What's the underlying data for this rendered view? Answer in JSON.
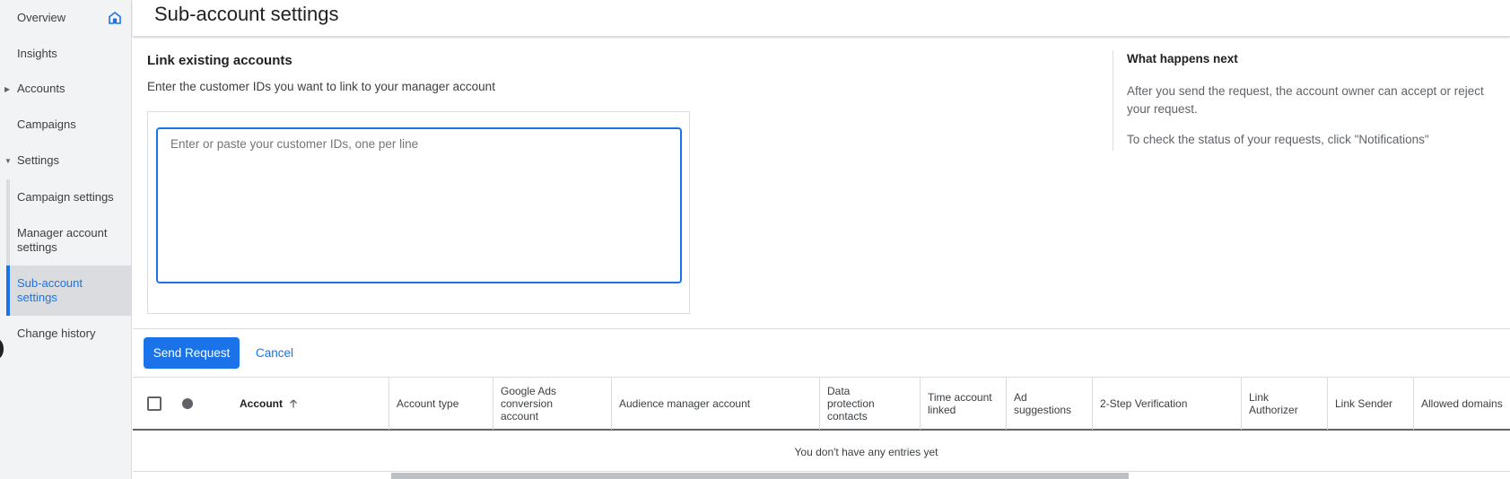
{
  "sidebar": {
    "items": [
      {
        "label": "Overview"
      },
      {
        "label": "Insights"
      },
      {
        "label": "Accounts"
      },
      {
        "label": "Campaigns"
      },
      {
        "label": "Settings"
      }
    ],
    "sub_items": [
      {
        "label": "Campaign settings"
      },
      {
        "label": "Manager account settings"
      },
      {
        "label": "Sub-account settings"
      },
      {
        "label": "Change history"
      }
    ],
    "active_color": "#1a73e8"
  },
  "header": {
    "title": "Sub-account settings"
  },
  "link_section": {
    "title": "Link existing accounts",
    "description": "Enter the customer IDs you want to link to your manager account",
    "textarea_placeholder": "Enter or paste your customer IDs, one per line",
    "textarea_value": ""
  },
  "info": {
    "title": "What happens next",
    "text_1": "After you send the request, the account owner can accept or reject your request.",
    "text_2": "To check the status of your requests, click \"Notifications\""
  },
  "actions": {
    "send_label": "Send Request",
    "cancel_label": "Cancel"
  },
  "table": {
    "columns": [
      "Account",
      "Account type",
      "Google Ads conversion account",
      "Audience manager account",
      "Data protection contacts",
      "Time account linked",
      "Ad suggestions",
      "2-Step Verification",
      "Link Authorizer",
      "Link Sender",
      "Allowed domains"
    ],
    "sort": "ascending",
    "empty_message": "You don't have any entries yet"
  },
  "icons": {
    "overview": "home-icon",
    "accounts": "caret-right-icon",
    "settings": "caret-down-icon",
    "sort": "arrow-up-icon"
  }
}
